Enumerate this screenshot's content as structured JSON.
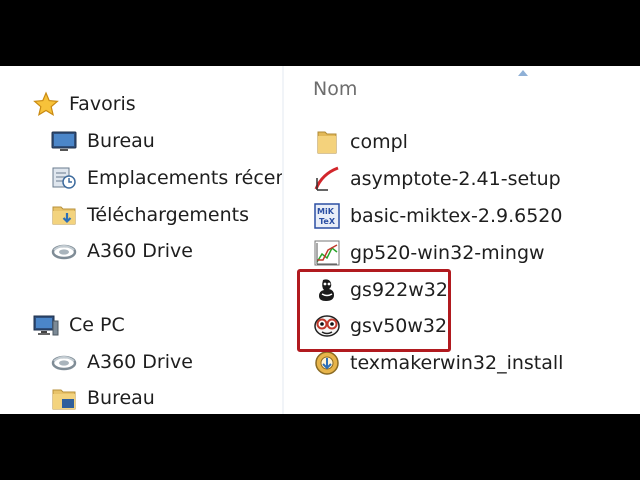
{
  "navigation": {
    "favorites": {
      "label": "Favoris",
      "icon": "star-icon",
      "items": [
        {
          "label": "Bureau",
          "icon": "desktop-icon"
        },
        {
          "label": "Emplacements récents",
          "icon": "recent-places-icon"
        },
        {
          "label": "Téléchargements",
          "icon": "downloads-folder-icon"
        },
        {
          "label": "A360 Drive",
          "icon": "cloud-drive-icon"
        }
      ]
    },
    "this_pc": {
      "label": "Ce PC",
      "icon": "computer-icon",
      "items": [
        {
          "label": "A360 Drive",
          "icon": "cloud-drive-icon"
        },
        {
          "label": "Bureau",
          "icon": "desktop-folder-icon"
        }
      ]
    }
  },
  "file_list": {
    "column_header": "Nom",
    "sort_direction": "ascending",
    "files": [
      {
        "name": "compl",
        "icon": "folder-icon"
      },
      {
        "name": "asymptote-2.41-setup",
        "icon": "asymptote-icon"
      },
      {
        "name": "basic-miktex-2.9.6520",
        "icon": "miktex-icon"
      },
      {
        "name": "gp520-win32-mingw",
        "icon": "gnuplot-icon"
      },
      {
        "name": "gs922w32",
        "icon": "ghostscript-icon"
      },
      {
        "name": "gsv50w32",
        "icon": "gsview-icon"
      },
      {
        "name": "texmakerwin32_install",
        "icon": "texmaker-installer-icon"
      }
    ]
  },
  "annotation": {
    "highlighted_files": [
      "gs922w32",
      "gsv50w32"
    ],
    "color": "#b11a1f"
  }
}
